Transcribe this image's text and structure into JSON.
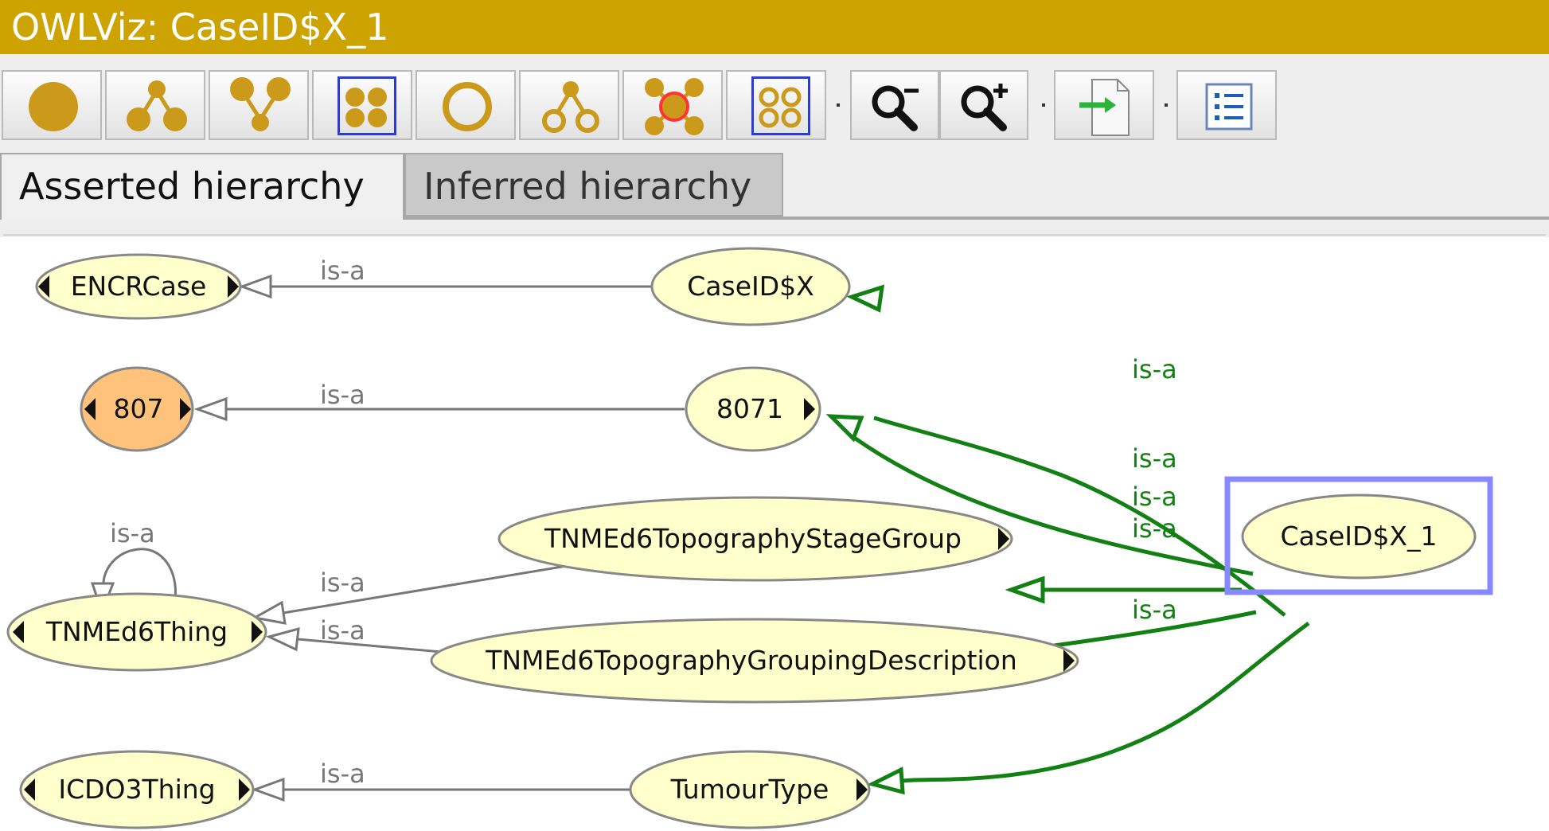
{
  "window": {
    "title": "OWLViz: CaseID$X_1"
  },
  "toolbar": {
    "buttons": [
      {
        "name": "show-class-button",
        "icon": "filled-circle-icon"
      },
      {
        "name": "show-subclasses-button",
        "icon": "filled-subclass-tree-icon"
      },
      {
        "name": "show-superclasses-button",
        "icon": "filled-superclass-tree-icon"
      },
      {
        "name": "show-all-classes-button",
        "icon": "filled-four-circles-icon",
        "selected": true
      },
      {
        "name": "hide-class-button",
        "icon": "ring-icon"
      },
      {
        "name": "hide-subclasses-button",
        "icon": "ring-subclass-tree-icon"
      },
      {
        "name": "hide-others-button",
        "icon": "hide-others-icon"
      },
      {
        "name": "hide-all-classes-button",
        "icon": "ring-four-circles-icon",
        "selected": true
      },
      {
        "name": "zoom-out-button",
        "icon": "zoom-out-icon"
      },
      {
        "name": "zoom-in-button",
        "icon": "zoom-in-icon"
      },
      {
        "name": "export-button",
        "icon": "export-icon"
      },
      {
        "name": "options-button",
        "icon": "options-list-icon"
      }
    ]
  },
  "tabs": [
    {
      "label": "Asserted hierarchy",
      "active": true
    },
    {
      "label": "Inferred hierarchy",
      "active": false
    }
  ],
  "graph": {
    "nodes": {
      "encrcase": "ENCRCase",
      "caseidx": "CaseID$X",
      "n807": "807",
      "n8071": "8071",
      "stagegroup": "TNMEd6TopographyStageGroup",
      "tnmthing": "TNMEd6Thing",
      "groupingdesc": "TNMEd6TopographyGroupingDescription",
      "icdo3thing": "ICDO3Thing",
      "tumourtype": "TumourType",
      "caseidx1": "CaseID$X_1"
    },
    "edge_label": "is-a",
    "colors": {
      "node_fill": "#ffffcc",
      "node_highlight": "#ffc27a",
      "edge_gray": "#777777",
      "edge_green": "#138013",
      "selection": "#8888ff"
    }
  }
}
